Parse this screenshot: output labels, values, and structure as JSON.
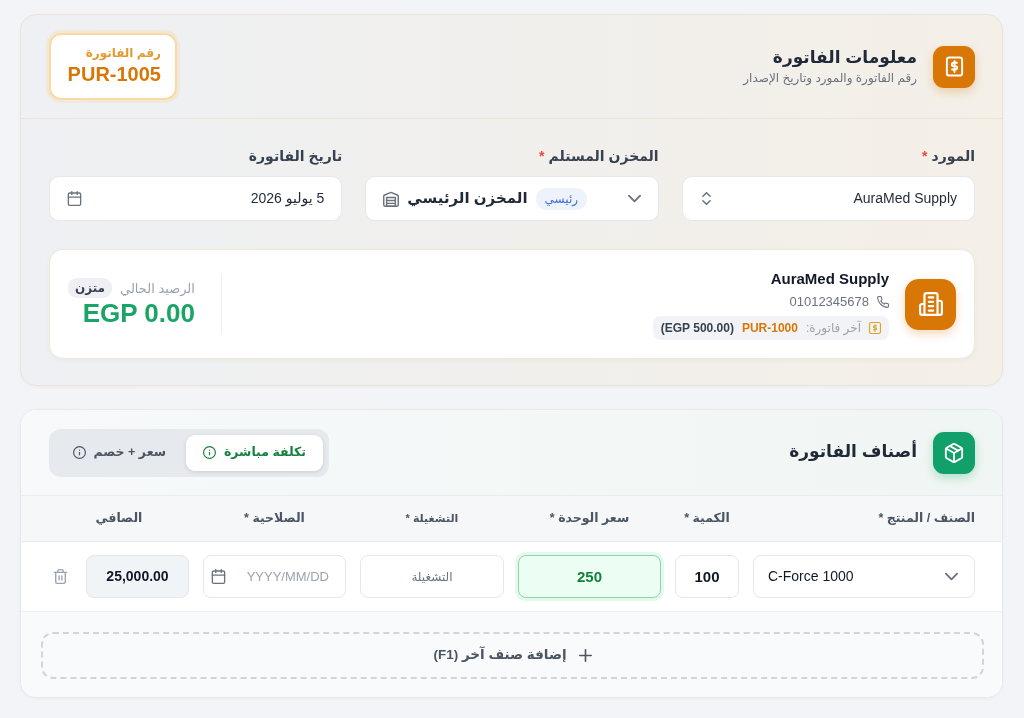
{
  "invoice_info": {
    "title": "معلومات الفاتورة",
    "subtitle": "رقم الفاتورة والمورد وتاريخ الإصدار",
    "invoice_number": {
      "label": "رقم الفاتورة",
      "value": "PUR-1005"
    },
    "fields": [
      {
        "kind": "select",
        "label": "المورد",
        "required_mark": "*",
        "value": "AuraMed Supply"
      },
      {
        "kind": "warehouse",
        "label": "المخزن المستلم",
        "required_mark": "*",
        "value": "المخزن الرئيسي",
        "badge": "رئيسي"
      },
      {
        "kind": "date",
        "label": "تاريخ الفاتورة",
        "value": "5 يوليو 2026"
      }
    ],
    "supplier_card": {
      "name": "AuraMed Supply",
      "phone": "01012345678",
      "last_invoice_label": "آخر فاتورة:",
      "last_invoice_number": "PUR-1000",
      "last_invoice_amount": "(EGP 500.00)",
      "balance_label": "الرصيد الحالي",
      "balance_status": "متزن",
      "balance": "EGP 0.00"
    }
  },
  "items": {
    "title": "أصناف الفاتورة",
    "modes": [
      {
        "label": "تكلفة مباشرة",
        "selected": true
      },
      {
        "label": "سعر + خصم",
        "selected": false
      }
    ],
    "columns": [
      "الصنف / المنتج *",
      "الكمية *",
      "سعر الوحدة *",
      "التشغيلة *",
      "الصلاحية *",
      "الصافي"
    ],
    "rows": [
      {
        "product": "C-Force 1000",
        "quantity": "100",
        "unit_price": "250",
        "price_focused": true,
        "batch": {
          "placeholder": "التشغيلة"
        },
        "expiry": {
          "placeholder": "YYYY/MM/DD"
        },
        "net": "25,000.00"
      }
    ],
    "add_button": "إضافة صنف آخر (F1)"
  }
}
